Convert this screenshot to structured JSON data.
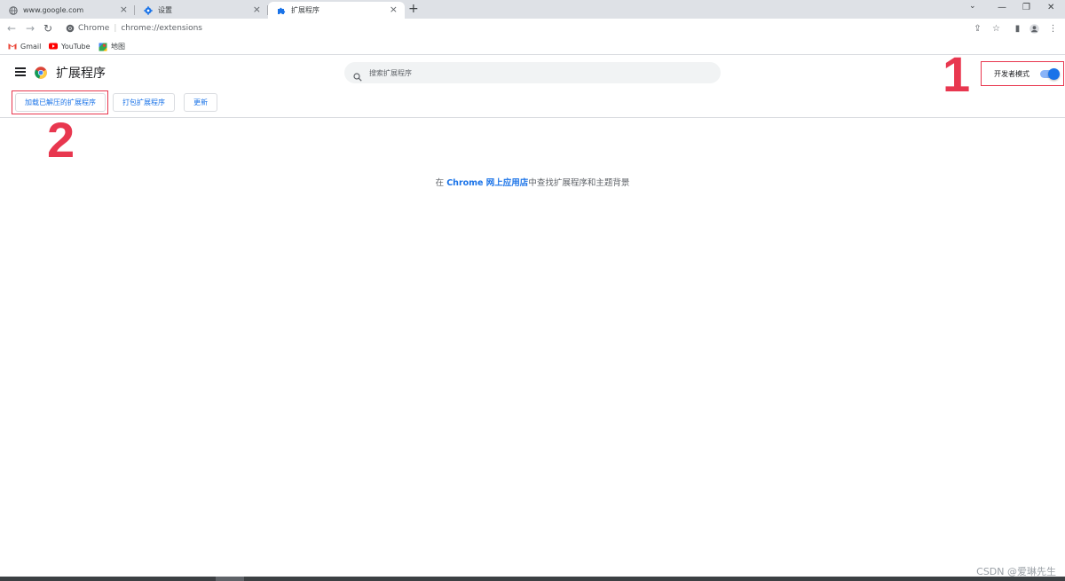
{
  "tabs": [
    {
      "title": "www.google.com",
      "icon": "globe-icon"
    },
    {
      "title": "设置",
      "icon": "gear-icon"
    },
    {
      "title": "扩展程序",
      "icon": "puzzle-icon",
      "active": true
    }
  ],
  "window": {
    "minimize": "⌄",
    "min2": "—",
    "restore": "❐",
    "close": "✕"
  },
  "omnibox": {
    "chrome_label": "Chrome",
    "url": "chrome://extensions"
  },
  "bookmarks": [
    {
      "label": "Gmail",
      "icon": "gmail-icon"
    },
    {
      "label": "YouTube",
      "icon": "youtube-icon"
    },
    {
      "label": "地图",
      "icon": "maps-icon"
    }
  ],
  "header": {
    "title": "扩展程序",
    "search_placeholder": "搜索扩展程序",
    "dev_mode_label": "开发者模式",
    "dev_mode_on": true
  },
  "toolbar": {
    "load_unpacked": "加载已解压的扩展程序",
    "pack": "打包扩展程序",
    "update": "更新"
  },
  "annotations": {
    "one": "1",
    "two": "2"
  },
  "empty_state": {
    "prefix": "在 ",
    "link": "Chrome 网上应用店",
    "suffix": "中查找扩展程序和主题背景"
  },
  "watermark": "CSDN @爱琳先生",
  "colors": {
    "accent": "#1a73e8",
    "annotation": "#e8374f"
  }
}
